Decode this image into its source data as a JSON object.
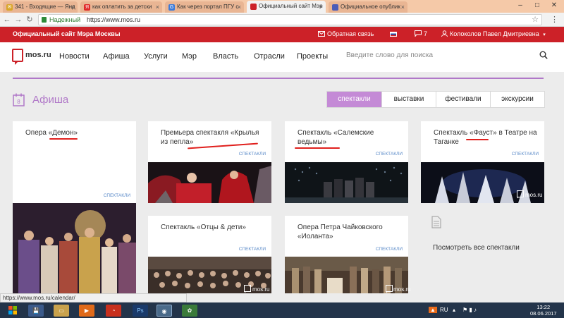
{
  "browser": {
    "tabs": [
      {
        "label": "341 - Входящие — Янд",
        "icon_color": "#d9a527"
      },
      {
        "label": "как оплатить за детски",
        "icon_color": "#e02a2a"
      },
      {
        "label": "Как через портал ПГУ с",
        "icon_color": "#3d7bd8"
      },
      {
        "label": "Официальный сайт Мэр",
        "icon_color": "#cc2128"
      },
      {
        "label": "Официальное опублик",
        "icon_color": "#4b5cb8"
      }
    ],
    "secure_label": "Надежный",
    "url": "https://www.mos.ru"
  },
  "topbar": {
    "site_name": "Официальный сайт Мэра Москвы",
    "feedback": "Обратная связь",
    "messages_count": "7",
    "user_name": "Колоколов Павел Дмитриевна"
  },
  "header": {
    "logo": "mos.ru",
    "nav": [
      "Новости",
      "Афиша",
      "Услуги",
      "Мэр",
      "Власть",
      "Отрасли",
      "Проекты"
    ],
    "search_placeholder": "Введите слово для поиска"
  },
  "afisha": {
    "title": "Афиша",
    "filters": [
      "спектакли",
      "выставки",
      "фестивали",
      "экскурсии"
    ],
    "active_filter": "спектакли",
    "cards": [
      {
        "title": "Опера «Демон»",
        "tag": "СПЕКТАКЛИ"
      },
      {
        "title": "Премьера спектакля «Крылья из пепла»",
        "tag": "СПЕКТАКЛИ"
      },
      {
        "title": "Спектакль «Салемские ведьмы»",
        "tag": "СПЕКТАКЛИ"
      },
      {
        "title": "Спектакль «Фауст» в Театре на Таганке",
        "tag": "СПЕКТАКЛИ"
      },
      {
        "title": "Спектакль «Отцы & дети»",
        "tag": "СПЕКТАКЛИ"
      },
      {
        "title": "Опера Петра Чайковского «Иоланта»",
        "tag": "СПЕКТАКЛИ"
      }
    ],
    "watermark": "mos.ru",
    "see_all": "Посмотреть все спектакли"
  },
  "status_url": "https://www.mos.ru/calendar/",
  "taskbar": {
    "lang": "RU",
    "time": "13:22",
    "date": "08.06.2017"
  }
}
